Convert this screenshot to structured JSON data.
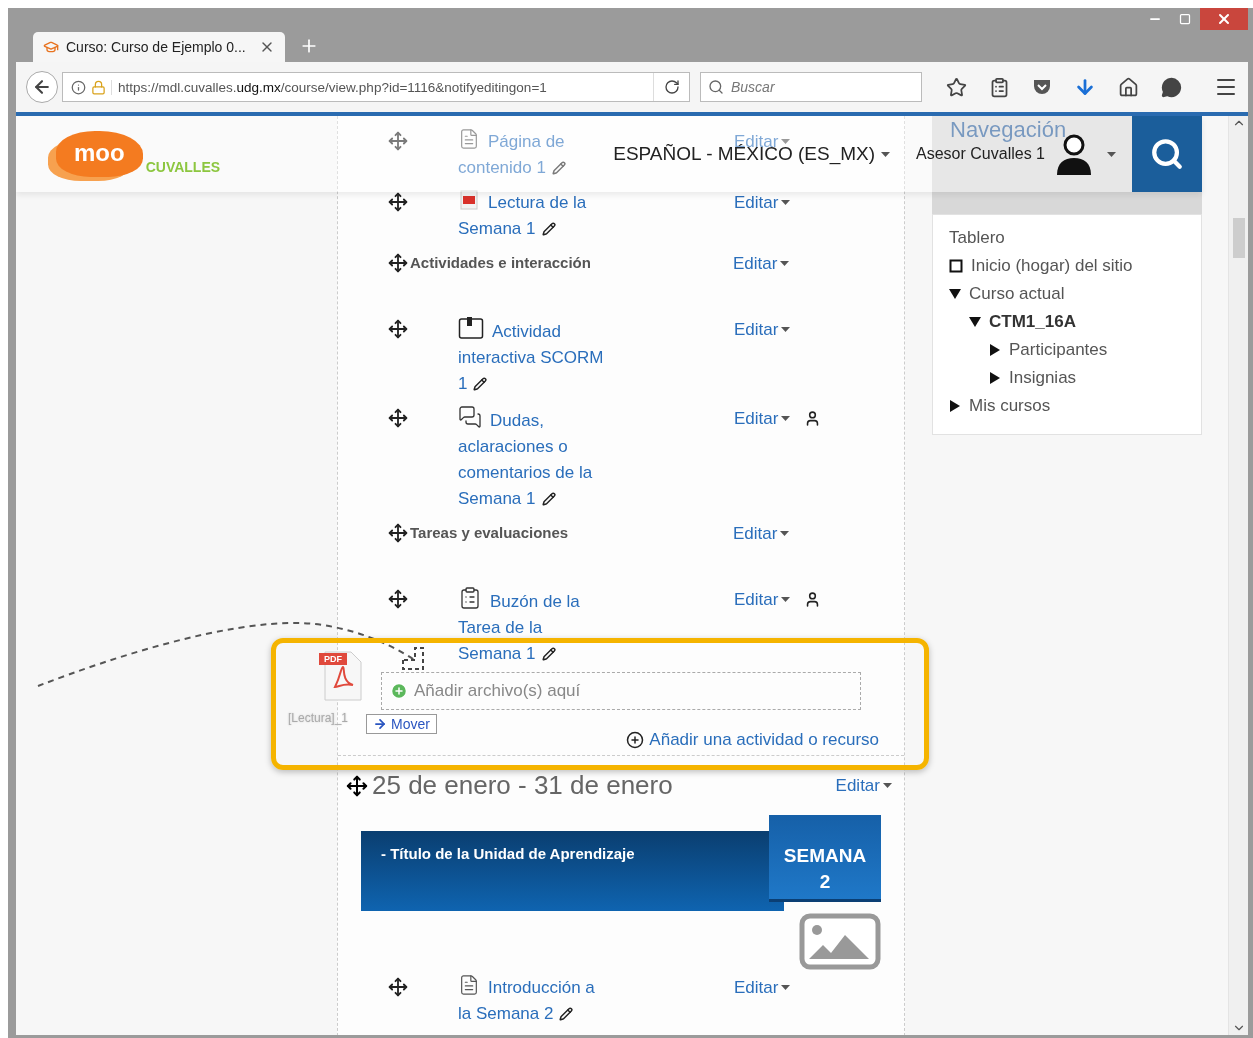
{
  "browser": {
    "tab": {
      "title": "Curso: Curso de Ejemplo 0..."
    },
    "url": "https://mdl.cuvalles.**udg.mx**/course/view.php?id=1116&notifyeditingon=1",
    "search": {
      "placeholder": "Buscar"
    }
  },
  "header": {
    "logo": {
      "mark": "moo",
      "name": "CUVALLES"
    },
    "language": "ESPAÑOL - MÉXICO (ES_MX)",
    "user": "Asesor Cuvalles 1"
  },
  "course": {
    "sections": [
      {
        "items": [
          {
            "kind": "page",
            "title": "Página de contenido 1",
            "edit": "Editar",
            "groups": false
          },
          {
            "kind": "pdf",
            "title": "Lectura de la Semana 1",
            "edit": "Editar",
            "groups": false
          },
          {
            "kind": "label",
            "title": "Actividades e interacción",
            "edit": "Editar"
          },
          {
            "kind": "scorm",
            "title": "Actividad interactiva SCORM 1",
            "edit": "Editar",
            "groups": false
          },
          {
            "kind": "forum",
            "title": "Dudas, aclaraciones o comentarios de la Semana 1",
            "edit": "Editar",
            "groups": true
          },
          {
            "kind": "label",
            "title": "Tareas y evaluaciones",
            "edit": "Editar"
          },
          {
            "kind": "assignment",
            "title": "Buzón de la Tarea de la Semana 1",
            "edit": "Editar",
            "groups": true
          }
        ],
        "dropzone": "Añadir archivo(s) aquí",
        "add_activity": "Añadir una actividad o recurso"
      },
      {
        "title": "25 de enero - 31 de enero",
        "edit": "Editar",
        "banner": {
          "title": "- Título de la Unidad de Aprendizaje",
          "badge": "SEMANA 2"
        },
        "items": [
          {
            "kind": "page",
            "title": "Introducción a la Semana 2",
            "edit": "Editar",
            "groups": false
          }
        ]
      }
    ]
  },
  "drag": {
    "file_type": "PDF",
    "file": "[Lectura]_1",
    "tooltip": "Mover"
  },
  "navigation": {
    "title": "Navegación",
    "items": [
      {
        "label": "Tablero",
        "kind": "plain",
        "current": false
      },
      {
        "label": "Inicio (hogar) del sitio",
        "kind": "page",
        "current": false
      },
      {
        "label": "Curso actual",
        "kind": "branch",
        "expanded": true,
        "current": false,
        "children": [
          {
            "label": "CTM1_16A",
            "kind": "branch",
            "expanded": true,
            "current": true,
            "children": [
              {
                "label": "Participantes",
                "kind": "branch",
                "expanded": false,
                "current": false
              },
              {
                "label": "Insignias",
                "kind": "branch",
                "expanded": false,
                "current": false
              }
            ]
          }
        ]
      },
      {
        "label": "Mis cursos",
        "kind": "branch",
        "expanded": false,
        "current": false
      }
    ]
  }
}
